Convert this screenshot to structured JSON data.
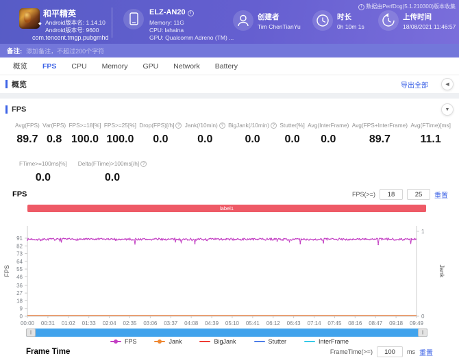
{
  "header": {
    "app": {
      "name": "和平精英",
      "version_name": "Android版本名: 1.14.10",
      "version_code": "Android版本号: 9600",
      "package": "com.tencent.tmgp.pubgmhd"
    },
    "device": {
      "model": "ELZ-AN20",
      "memory": "Memory: 11G",
      "cpu": "CPU: lahaina",
      "gpu": "GPU: Qualcomm Adreno (TM) ..."
    },
    "creator": {
      "label": "创建者",
      "value": "Tim ChenTianYu"
    },
    "duration": {
      "label": "时长",
      "value": "0h 10m 1s"
    },
    "upload": {
      "label": "上传时间",
      "value": "18/08/2021 11:46:57"
    },
    "collector_note": "数据由PerfDog(5.1.210300)版本收集"
  },
  "notes": {
    "label": "备注:",
    "placeholder": "添加备注，不超过200个字符"
  },
  "tabs": [
    {
      "key": "overview",
      "label": "概览",
      "active": false
    },
    {
      "key": "fps",
      "label": "FPS",
      "active": true
    },
    {
      "key": "cpu",
      "label": "CPU",
      "active": false
    },
    {
      "key": "memory",
      "label": "Memory",
      "active": false
    },
    {
      "key": "gpu",
      "label": "GPU",
      "active": false
    },
    {
      "key": "network",
      "label": "Network",
      "active": false
    },
    {
      "key": "battery",
      "label": "Battery",
      "active": false
    }
  ],
  "overview": {
    "title": "概览",
    "export_all": "导出全部"
  },
  "fps_panel": {
    "title": "FPS",
    "metrics_row1": [
      {
        "label": "Avg(FPS)",
        "value": "89.7",
        "help": false
      },
      {
        "label": "Var(FPS)",
        "value": "0.8",
        "help": false
      },
      {
        "label": "FPS>=18[%]",
        "value": "100.0",
        "help": false
      },
      {
        "label": "FPS>=25[%]",
        "value": "100.0",
        "help": false
      },
      {
        "label": "Drop(FPS)[/h]",
        "value": "0.0",
        "help": true
      },
      {
        "label": "Jank(/10min)",
        "value": "0.0",
        "help": true
      },
      {
        "label": "BigJank(/10min)",
        "value": "0.0",
        "help": true
      },
      {
        "label": "Stutter[%]",
        "value": "0.0",
        "help": false
      },
      {
        "label": "Avg(InterFrame)",
        "value": "0.0",
        "help": false
      },
      {
        "label": "Avg(FPS+InterFrame)",
        "value": "89.7",
        "help": false
      },
      {
        "label": "Avg(FTime)[ms]",
        "value": "11.1",
        "help": false
      }
    ],
    "metrics_row2": [
      {
        "label": "FTime>=100ms[%]",
        "value": "0.0",
        "help": false
      },
      {
        "label": "Delta(FTime)>100ms[/h]",
        "value": "0.0",
        "help": true
      }
    ],
    "chart_title": "FPS",
    "fps_threshold": {
      "label": "FPS(>=)",
      "input1": "18",
      "input2": "25",
      "reset": "重置"
    },
    "label_bar": "label1"
  },
  "chart_data": {
    "type": "line",
    "title": "FPS",
    "ylabel_left": "FPS",
    "ylabel_right": "Jank",
    "y_ticks_left": [
      91,
      82,
      73,
      64,
      55,
      46,
      36,
      27,
      18,
      9,
      0
    ],
    "y_ticks_right": [
      1,
      0
    ],
    "ylim_left": [
      0,
      91
    ],
    "ylim_right": [
      0,
      1
    ],
    "x_ticks": [
      "00:00",
      "00:31",
      "01:02",
      "01:33",
      "02:04",
      "02:35",
      "03:06",
      "03:37",
      "04:08",
      "04:39",
      "05:10",
      "05:41",
      "06:12",
      "06:43",
      "07:14",
      "07:45",
      "08:16",
      "08:47",
      "09:18",
      "09:49"
    ],
    "grid": false,
    "legend_position": "bottom",
    "series": [
      {
        "name": "FPS",
        "color": "#c33fc3",
        "marker": "dot",
        "behavior": "noisy-flat",
        "baseline": 89.7,
        "noise_amplitude": 1.1,
        "dip_chance": 0.05,
        "dip_min": 84,
        "points": 540
      },
      {
        "name": "Jank",
        "color": "#ee8833",
        "marker": "dot",
        "behavior": "constant",
        "value": 0
      },
      {
        "name": "BigJank",
        "color": "#ee3b33",
        "marker": "line",
        "behavior": "constant",
        "value": 0
      },
      {
        "name": "Stutter",
        "color": "#4d7de8",
        "marker": "line",
        "behavior": "constant",
        "value": 0
      },
      {
        "name": "InterFrame",
        "color": "#35c9e8",
        "marker": "line",
        "behavior": "constant",
        "value": 0
      }
    ]
  },
  "frame_time": {
    "title": "Frame Time",
    "threshold_label": "FrameTime(>=)",
    "threshold_value": "100",
    "unit": "ms",
    "reset": "重置"
  },
  "icons": {
    "collapse_left": "◀",
    "collapse_panel": "▼",
    "info": "i",
    "help": "?",
    "handle": "||",
    "diamond": "◆"
  },
  "colors": {
    "accent_blue": "#3d63e6",
    "header_purple": "#5f5fce",
    "label_bar_red": "#ee5a66",
    "scrollbar_blue": "#41a3ec"
  }
}
